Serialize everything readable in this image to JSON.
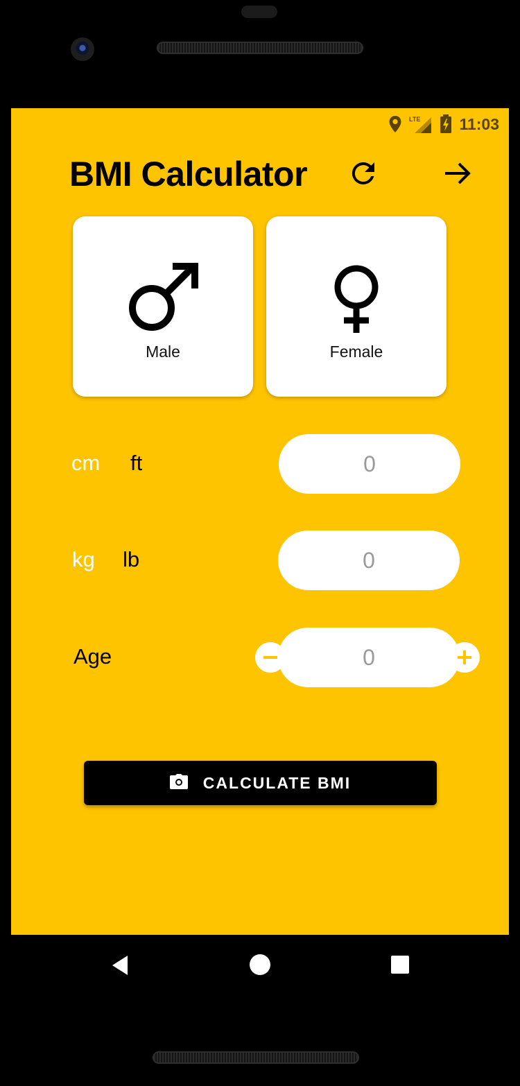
{
  "status_bar": {
    "time": "11:03",
    "network": "LTE"
  },
  "app": {
    "title": "BMI Calculator",
    "icons": {
      "refresh": "refresh-icon",
      "next": "arrow-right-icon"
    }
  },
  "gender": {
    "male": {
      "label": "Male",
      "icon": "male-symbol-icon"
    },
    "female": {
      "label": "Female",
      "icon": "female-symbol-icon"
    }
  },
  "height": {
    "units": [
      "cm",
      "ft"
    ],
    "selected_unit": "cm",
    "value": "0"
  },
  "weight": {
    "units": [
      "kg",
      "lb"
    ],
    "selected_unit": "kg",
    "value": "0"
  },
  "age": {
    "label": "Age",
    "value": "0",
    "minus_icon": "minus-icon",
    "plus_icon": "plus-icon"
  },
  "calculate_button": {
    "label": "CALCULATE BMI",
    "icon": "camera-icon"
  },
  "colors": {
    "accent": "#ffc400",
    "active_unit": "#ffffff",
    "button": "#000000"
  }
}
